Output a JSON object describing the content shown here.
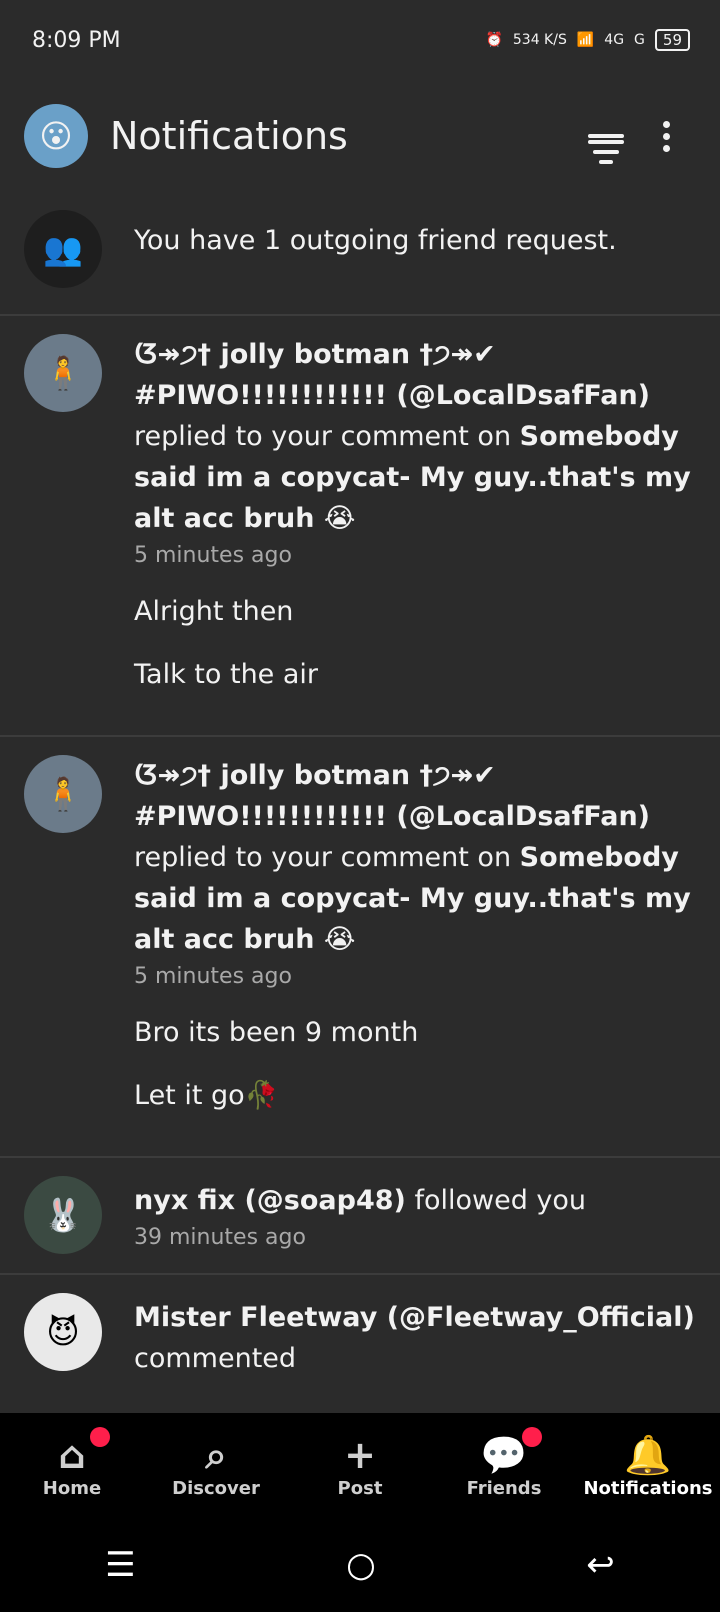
{
  "status": {
    "time": "8:09 PM",
    "speed": "534 K/S",
    "network1": "4G",
    "network2": "G",
    "battery": "59"
  },
  "header": {
    "title": "Notifications"
  },
  "notifications": [
    {
      "text": "You have 1 outgoing friend request."
    },
    {
      "user": "ᮃ↠੭† jolly botman †੭↠✔ #PIWO!!!!!!!!!!!! (@LocalDsafFan)",
      "action": " replied to your comment on ",
      "post": "Somebody said im a copycat- My guy..that's my alt acc bruh 😭",
      "time": "5 minutes ago",
      "line1": "Alright then",
      "line2": "Talk to the air"
    },
    {
      "user": "ᮃ↠੭† jolly botman †੭↠✔ #PIWO!!!!!!!!!!!! (@LocalDsafFan)",
      "action": " replied to your comment on ",
      "post": "Somebody said im a copycat- My guy..that's my alt acc bruh 😭",
      "time": "5 minutes ago",
      "line1": "Bro its been 9 month",
      "line2": "Let it go🥀"
    },
    {
      "user": "nyx fix (@soap48)",
      "action": " followed you",
      "time": "39 minutes ago"
    },
    {
      "user": "Mister Fleetway (@Fleetway_Official)",
      "action": " commented"
    }
  ],
  "nav": {
    "home": "Home",
    "discover": "Discover",
    "post": "Post",
    "friends": "Friends",
    "notifications": "Notifications"
  }
}
